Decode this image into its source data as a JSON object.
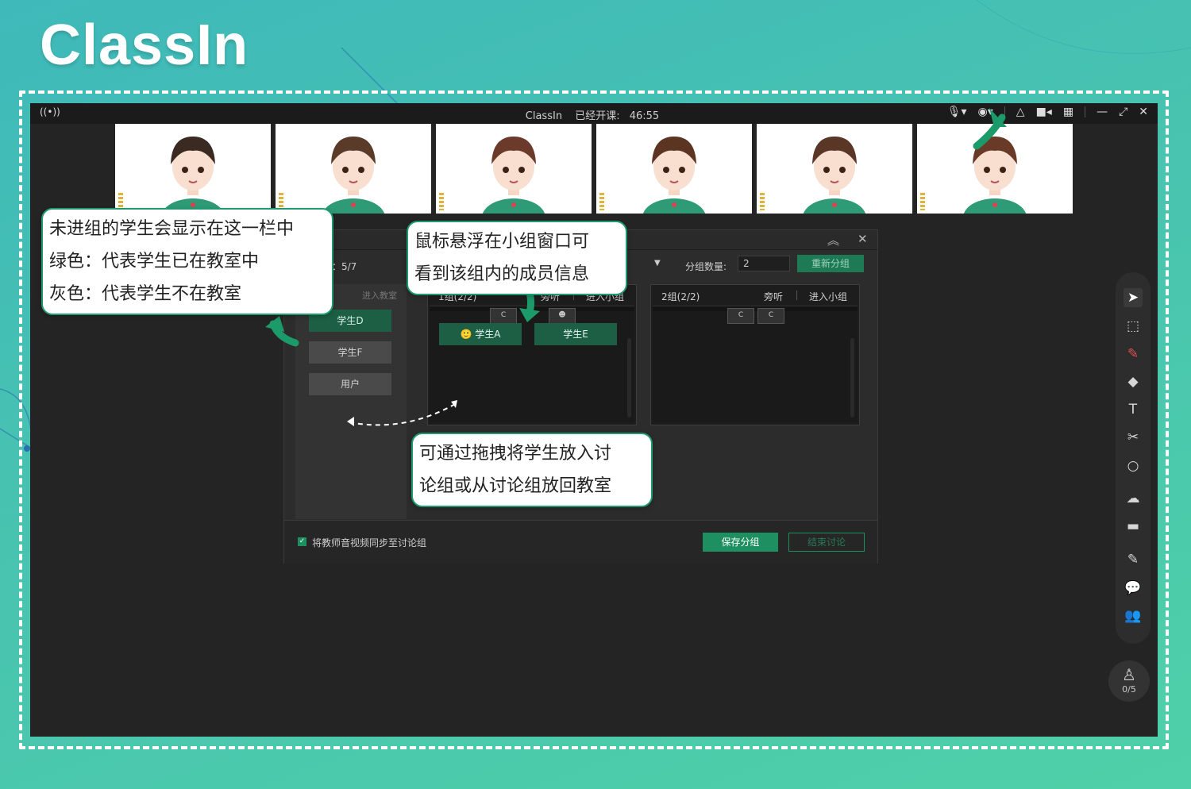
{
  "brand": {
    "logo_text": "ClassIn"
  },
  "titlebar": {
    "app_name": "ClassIn",
    "timer_label": "已经开课:",
    "timer_value": "46:55",
    "icons": [
      "broadcast-icon",
      "microphone-icon",
      "camera-icon",
      "group-icon",
      "video-icon",
      "grid-icon",
      "minimize-icon",
      "restore-icon",
      "close-icon"
    ]
  },
  "video_tiles": [
    {
      "name": "student-1"
    },
    {
      "name": "student-2"
    },
    {
      "name": "student-3"
    },
    {
      "name": "student-4"
    },
    {
      "name": "student-5"
    },
    {
      "name": "student-6"
    }
  ],
  "dialog": {
    "count_label": "：5/7",
    "group_count_label": "分组数量:",
    "group_count_value": "2",
    "regroup_button": "重新分组",
    "left_header": "进入教室",
    "ungrouped_students": [
      {
        "label": "学生D",
        "in_class": true
      },
      {
        "label": "学生F",
        "in_class": false
      },
      {
        "label": "用户",
        "in_class": false
      }
    ],
    "groups": [
      {
        "name": "1组(2/2)",
        "audit": "旁听",
        "enter": "进入小组",
        "members": [
          "学生A",
          "学生E"
        ]
      },
      {
        "name": "2组(2/2)",
        "audit": "旁听",
        "enter": "进入小组",
        "members": []
      }
    ],
    "sync_checkbox_label": "将教师音视频同步至讨论组",
    "sync_checked": true,
    "save_button": "保存分组",
    "end_button": "结束讨论"
  },
  "toolbar": {
    "tools": [
      "pointer-icon",
      "select-icon",
      "laser-icon",
      "eraser-icon",
      "text-icon",
      "scissors-icon",
      "shape-icon",
      "cloud-icon",
      "toolbox-icon",
      "edit-icon",
      "chat-icon",
      "members-icon"
    ],
    "seat_count": "0/5"
  },
  "callouts": {
    "ungrouped": [
      "未进组的学生会显示在这一栏中",
      "绿色：代表学生已在教室中",
      "灰色：代表学生不在教室"
    ],
    "hover": [
      "鼠标悬浮在小组窗口可",
      "看到该组内的成员信息"
    ],
    "drag": [
      "可通过拖拽将学生放入讨",
      "论组或从讨论组放回教室"
    ]
  },
  "colors": {
    "accent": "#1e8f60",
    "present_green": "#1c5f44",
    "absent_gray": "#4a4a4a",
    "frame_bg": "#242424"
  }
}
